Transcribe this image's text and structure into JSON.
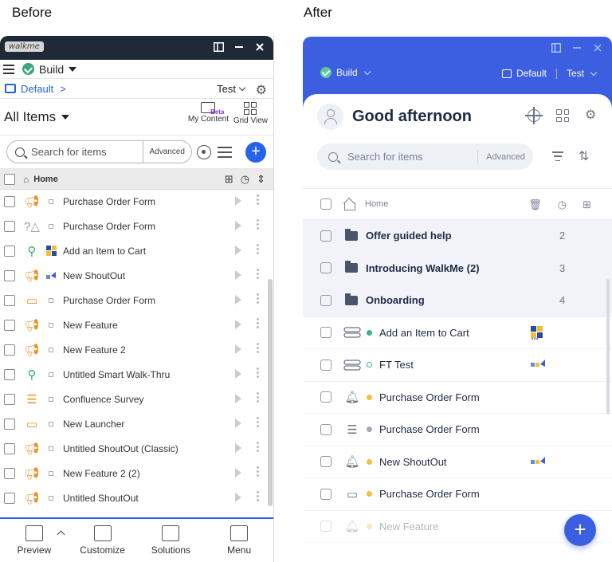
{
  "captions": {
    "before": "Before",
    "after": "After"
  },
  "before": {
    "logo": "walkme",
    "build_label": "Build",
    "env_label": "Default",
    "env_sep": ">",
    "test_label": "Test",
    "all_items_label": "All Items",
    "my_content_label": "My Content",
    "beta_label": "Beta",
    "grid_view_label": "Grid View",
    "search_placeholder": "Search for items",
    "advanced_label": "Advanced",
    "plus_label": "+",
    "home_label": "Home",
    "items": [
      {
        "label": "Purchase Order Form",
        "icon": "megaphone-icon",
        "color": "#e0952a"
      },
      {
        "label": "Purchase Order Form",
        "icon": "question-warning-icon",
        "color": "#999999"
      },
      {
        "label": "Add an Item to Cart",
        "icon": "smart-walkthru-icon",
        "color": "#3aa57a"
      },
      {
        "label": "New ShoutOut",
        "icon": "megaphone-icon",
        "color": "#e0952a"
      },
      {
        "label": "Purchase Order Form",
        "icon": "launcher-icon",
        "color": "#e0952a"
      },
      {
        "label": "New Feature",
        "icon": "megaphone-icon",
        "color": "#e0952a"
      },
      {
        "label": "New Feature 2",
        "icon": "megaphone-icon",
        "color": "#e0952a"
      },
      {
        "label": "Untitled Smart Walk-Thru",
        "icon": "smart-walkthru-icon",
        "color": "#3aa57a"
      },
      {
        "label": "Confluence Survey",
        "icon": "survey-icon",
        "color": "#e0952a"
      },
      {
        "label": "New Launcher",
        "icon": "launcher-icon",
        "color": "#e0952a"
      },
      {
        "label": "Untitled ShoutOut (Classic)",
        "icon": "megaphone-icon",
        "color": "#e0952a"
      },
      {
        "label": "New Feature 2 (2)",
        "icon": "megaphone-icon",
        "color": "#e0952a"
      },
      {
        "label": "Untitled ShoutOut",
        "icon": "megaphone-icon",
        "color": "#e0952a"
      }
    ],
    "bottom": [
      {
        "label": "Preview",
        "icon": "preview-icon"
      },
      {
        "label": "Customize",
        "icon": "paint-roller-icon"
      },
      {
        "label": "Solutions",
        "icon": "solutions-icon"
      },
      {
        "label": "Menu",
        "icon": "menu-icon"
      }
    ]
  },
  "after": {
    "build_label": "Build",
    "env_label": "Default",
    "test_label": "Test",
    "greeting": "Good afternoon",
    "search_placeholder": "Search for items",
    "advanced_label": "Advanced",
    "home_label": "Home",
    "folders": [
      {
        "label": "Offer guided help",
        "count": "2"
      },
      {
        "label": "Introducing WalkMe (2)",
        "count": "3"
      },
      {
        "label": "Onboarding",
        "count": "4"
      }
    ],
    "items": [
      {
        "label": "Add an Item to Cart",
        "icon": "smart-walkthru-icon",
        "status": "teal"
      },
      {
        "label": "FT Test",
        "icon": "smart-walkthru-icon",
        "status": "teal-outline"
      },
      {
        "label": "Purchase Order Form",
        "icon": "shoutout-icon",
        "status": "yellow"
      },
      {
        "label": "Purchase Order Form",
        "icon": "survey-icon",
        "status": "gray"
      },
      {
        "label": "New ShoutOut",
        "icon": "shoutout-icon",
        "status": "yellow"
      },
      {
        "label": "Purchase Order Form",
        "icon": "launcher-icon",
        "status": "yellow"
      },
      {
        "label": "New Feature",
        "icon": "shoutout-icon",
        "status": "yellow"
      }
    ],
    "fab_label": "+",
    "accent": "#3b5fe0"
  }
}
